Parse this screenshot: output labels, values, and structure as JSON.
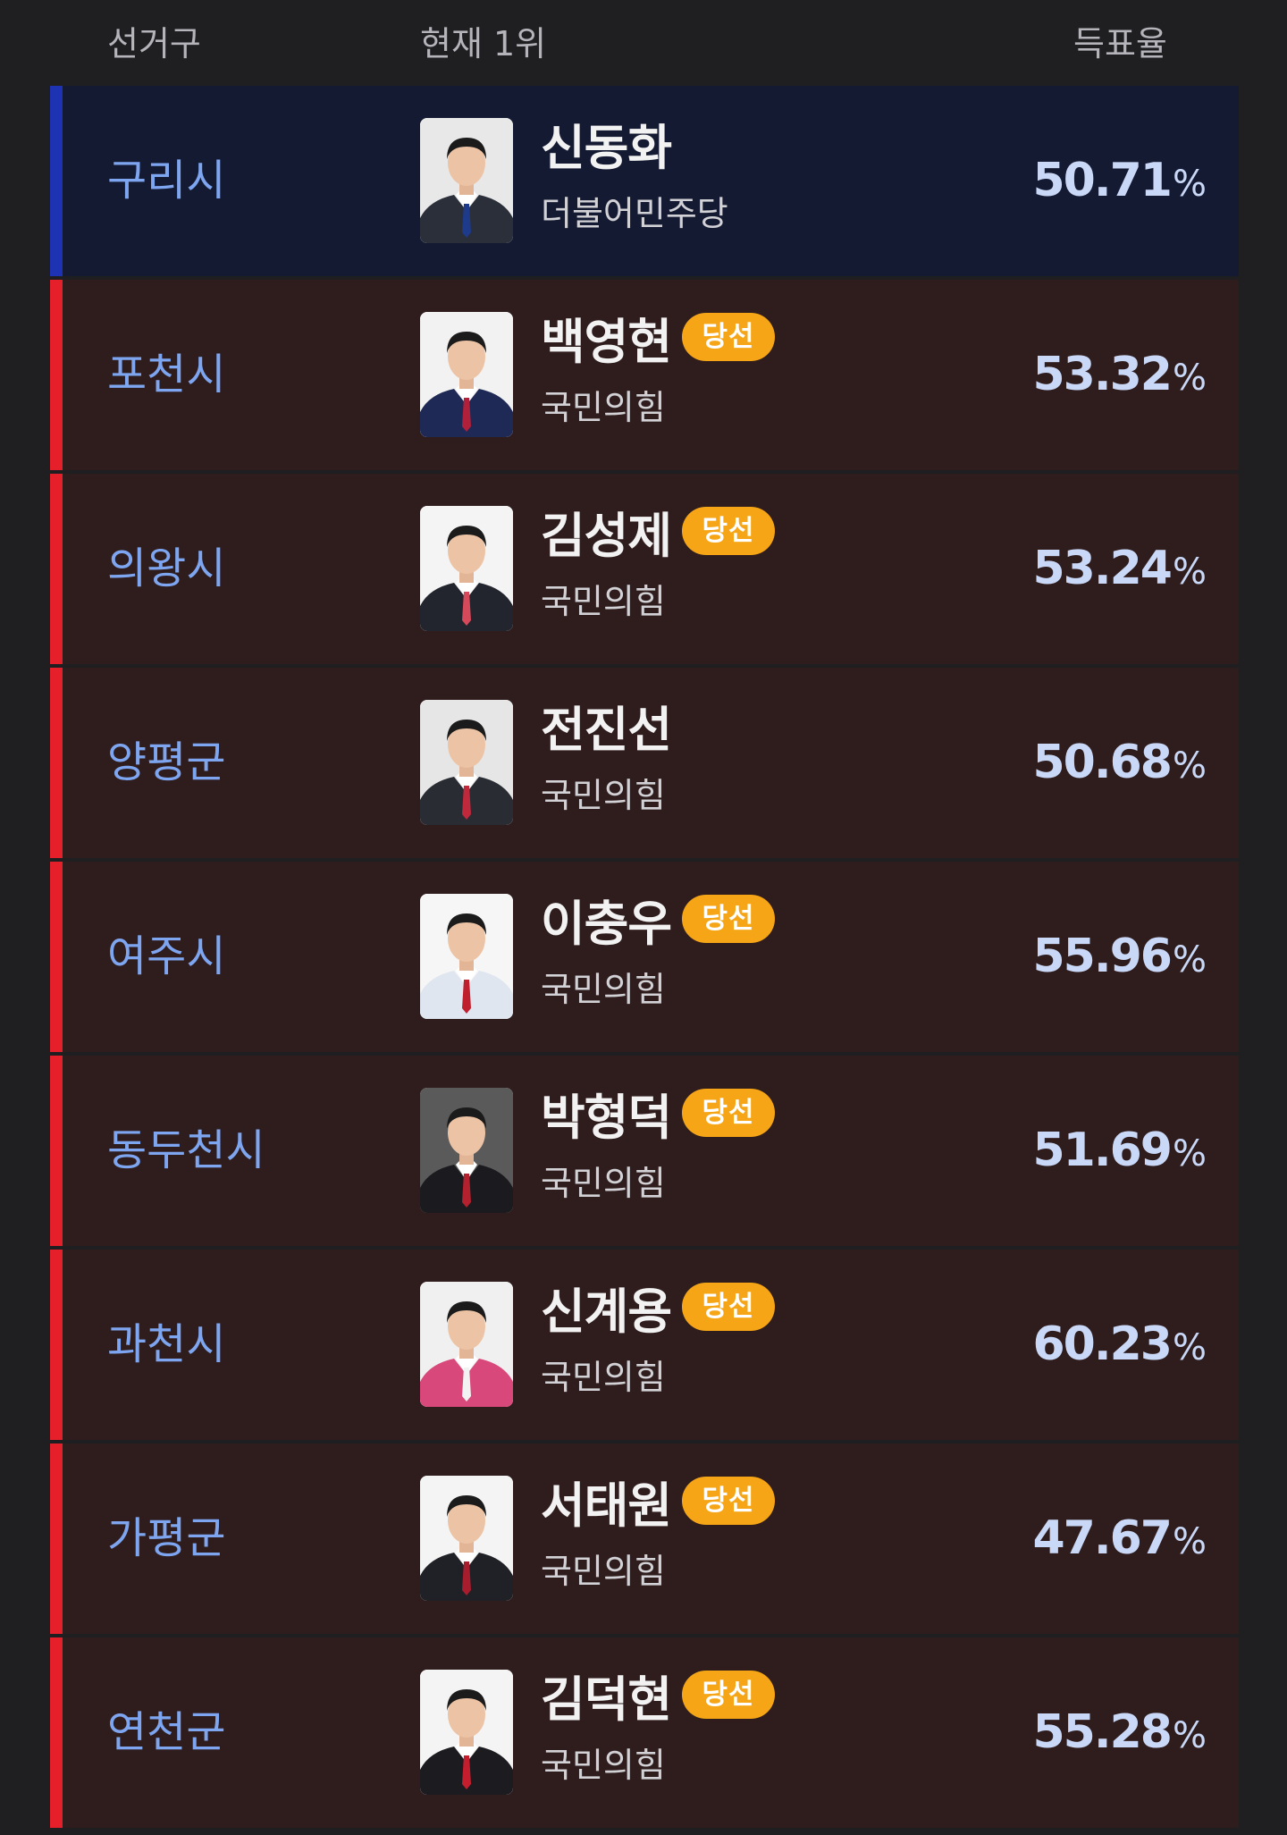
{
  "header": {
    "district_label": "선거구",
    "leader_label": "현재 1위",
    "rate_label": "득표율"
  },
  "colors": {
    "democratic": "#1e32b4",
    "people_power": "#e5202b",
    "winner_badge": "#f5a516"
  },
  "rows": [
    {
      "district": "구리시",
      "name": "신동화",
      "party": "더불어민주당",
      "party_color": "blue",
      "winner": false,
      "rate": "50.71",
      "unit": "%",
      "jacket": "#2a2f3a",
      "tie": "#1e3a8a",
      "bg": "#e8e8e8"
    },
    {
      "district": "포천시",
      "name": "백영현",
      "party": "국민의힘",
      "party_color": "red",
      "winner": true,
      "badge": "당선",
      "rate": "53.32",
      "unit": "%",
      "jacket": "#1e2a55",
      "tie": "#b0203a",
      "bg": "#f2f2f2"
    },
    {
      "district": "의왕시",
      "name": "김성제",
      "party": "국민의힘",
      "party_color": "red",
      "winner": true,
      "badge": "당선",
      "rate": "53.24",
      "unit": "%",
      "jacket": "#22252e",
      "tie": "#d6495a",
      "bg": "#f4f4f4"
    },
    {
      "district": "양평군",
      "name": "전진선",
      "party": "국민의힘",
      "party_color": "red",
      "winner": false,
      "rate": "50.68",
      "unit": "%",
      "jacket": "#2a2c33",
      "tie": "#c0283c",
      "bg": "#e6e6e6"
    },
    {
      "district": "여주시",
      "name": "이충우",
      "party": "국민의힘",
      "party_color": "red",
      "winner": true,
      "badge": "당선",
      "rate": "55.96",
      "unit": "%",
      "jacket": "#dfe6f0",
      "tie": "#c0202e",
      "bg": "#f6f6f6"
    },
    {
      "district": "동두천시",
      "name": "박형덕",
      "party": "국민의힘",
      "party_color": "red",
      "winner": true,
      "badge": "당선",
      "rate": "51.69",
      "unit": "%",
      "jacket": "#1b1b1f",
      "tie": "#b3202e",
      "bg": "#5a5a5a"
    },
    {
      "district": "과천시",
      "name": "신계용",
      "party": "국민의힘",
      "party_color": "red",
      "winner": true,
      "badge": "당선",
      "rate": "60.23",
      "unit": "%",
      "jacket": "#d9487a",
      "tie": "#f2f2f2",
      "bg": "#f0f0f0"
    },
    {
      "district": "가평군",
      "name": "서태원",
      "party": "국민의힘",
      "party_color": "red",
      "winner": true,
      "badge": "당선",
      "rate": "47.67",
      "unit": "%",
      "jacket": "#1f2126",
      "tie": "#a81d2e",
      "bg": "#f4f4f4"
    },
    {
      "district": "연천군",
      "name": "김덕현",
      "party": "국민의힘",
      "party_color": "red",
      "winner": true,
      "badge": "당선",
      "rate": "55.28",
      "unit": "%",
      "jacket": "#1c1c20",
      "tie": "#c41e2e",
      "bg": "#f4f4f4"
    }
  ]
}
